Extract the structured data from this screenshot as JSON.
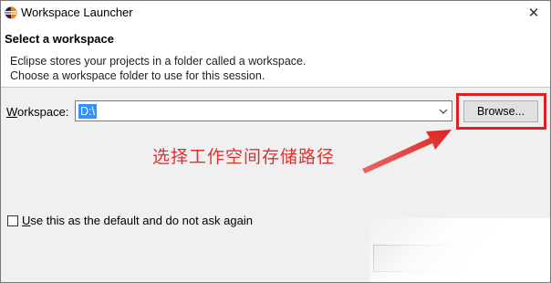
{
  "window": {
    "title": "Workspace Launcher",
    "close_symbol": "✕",
    "icon": "eclipse-icon"
  },
  "header": {
    "title": "Select a workspace",
    "description_line1": "Eclipse stores your projects in a folder called a workspace.",
    "description_line2": "Choose a workspace folder to use for this session."
  },
  "workspace": {
    "label_mnemonic": "W",
    "label_rest": "orkspace:",
    "value": "D:\\",
    "dropdown_icon": "chevron-down-icon"
  },
  "browse": {
    "label": "Browse..."
  },
  "annotation": {
    "text": "选择工作空间存储路径",
    "color": "#e03030"
  },
  "default_option": {
    "label_mnemonic": "U",
    "label_rest": "se this as the default and do not ask again",
    "checked": false
  },
  "colors": {
    "highlight_border": "#e02020",
    "selection": "#3390ff"
  }
}
